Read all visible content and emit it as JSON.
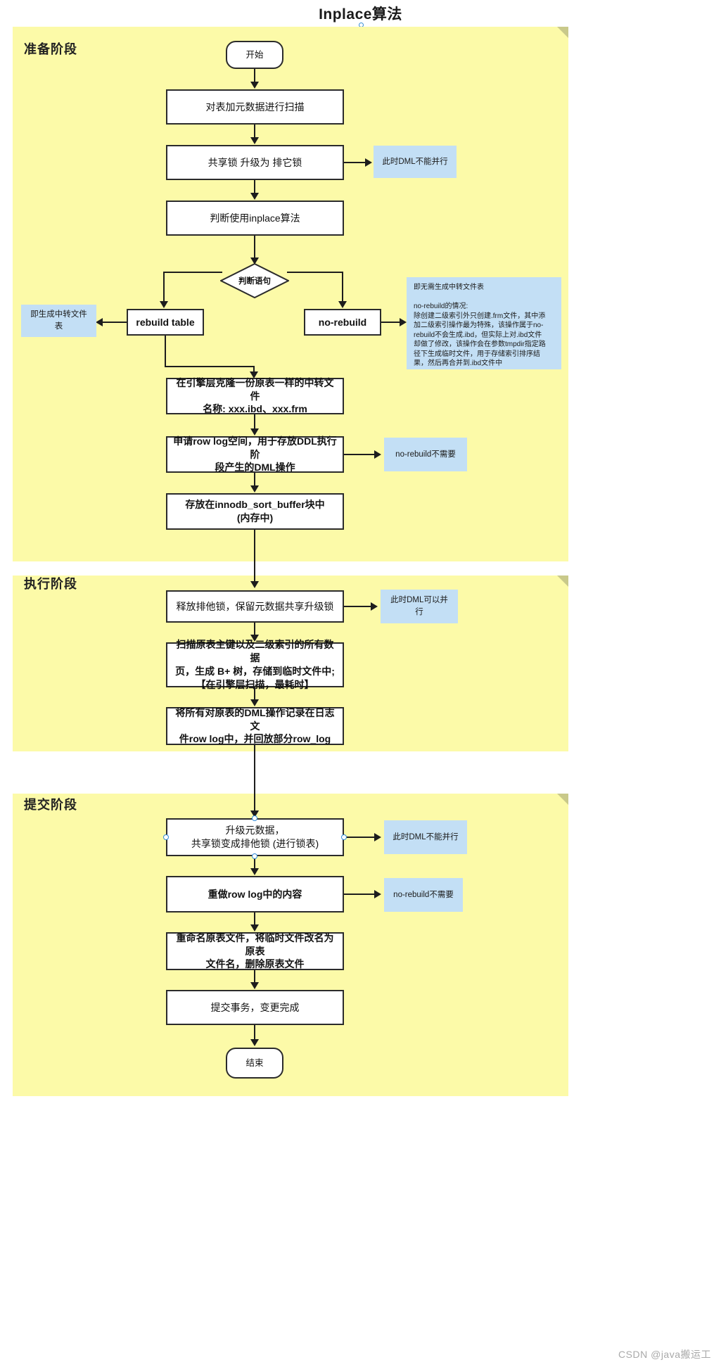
{
  "title": "Inplace算法",
  "watermark": "CSDN @java搬运工",
  "colors": {
    "phase_background": "#fcfaa8",
    "note_background": "#c3dff5",
    "node_border": "#2b2b2b",
    "connector": "#1d1d1d",
    "selection_handle": "#2f8ad8"
  },
  "phases": [
    {
      "label": "准备阶段"
    },
    {
      "label": "执行阶段"
    },
    {
      "label": "提交阶段"
    }
  ],
  "nodes": {
    "start": "开始",
    "scan_metadata": "对表加元数据进行扫描",
    "upgrade_lock": "共享锁 升级为 排它锁",
    "judge_inplace": "判断使用inplace算法",
    "decision": "判断语句",
    "rebuild_table": "rebuild table",
    "no_rebuild": "no-rebuild",
    "clone_file": "在引擎层克隆一份原表一样的中转文件\n名称: xxx.ibd、xxx.frm",
    "apply_row_log": "申请row log空间，用于存放DDL执行阶\n段产生的DML操作",
    "sort_buffer": "存放在innodb_sort_buffer块中\n(内存中)",
    "release_lock": "释放排他锁，保留元数据共享升级锁",
    "scan_pages": "扫描原表主键以及二级索引的所有数据\n页，生成 B+ 树，存储到临时文件中;\n【在引擎层扫描，最耗时】",
    "record_dml": "将所有对原表的DML操作记录在日志文\n件row log中，并回放部分row_log",
    "upgrade_metadata": "升级元数据，\n共享锁变成排他锁 (进行锁表)",
    "redo_row_log": "重做row log中的内容",
    "rename_files": "重命名原表文件，将临时文件改名为原表\n文件名，删除原表文件",
    "commit_tx": "提交事务，变更完成",
    "end": "结束"
  },
  "notes": {
    "dml_blocked_1": "此时DML不能并行",
    "generate_temp_table": "即生成中转文件表",
    "no_rebuild_detail": "即无需生成中转文件表\n\nno-rebuild的情况:\n除创建二级索引外只创建.frm文件，其中添\n加二级索引操作最为特殊，该操作属于no-\nrebuild不会生成.ibd，但实际上对.ibd文件\n却做了修改，该操作会在参数tmpdir指定路\n径下生成临时文件，用于存储索引排序结\n果，然后再合并到.ibd文件中",
    "no_rebuild_not_needed_1": "no-rebuild不需要",
    "dml_allowed": "此时DML可以并行",
    "dml_blocked_2": "此时DML不能并行",
    "no_rebuild_not_needed_2": "no-rebuild不需要"
  }
}
